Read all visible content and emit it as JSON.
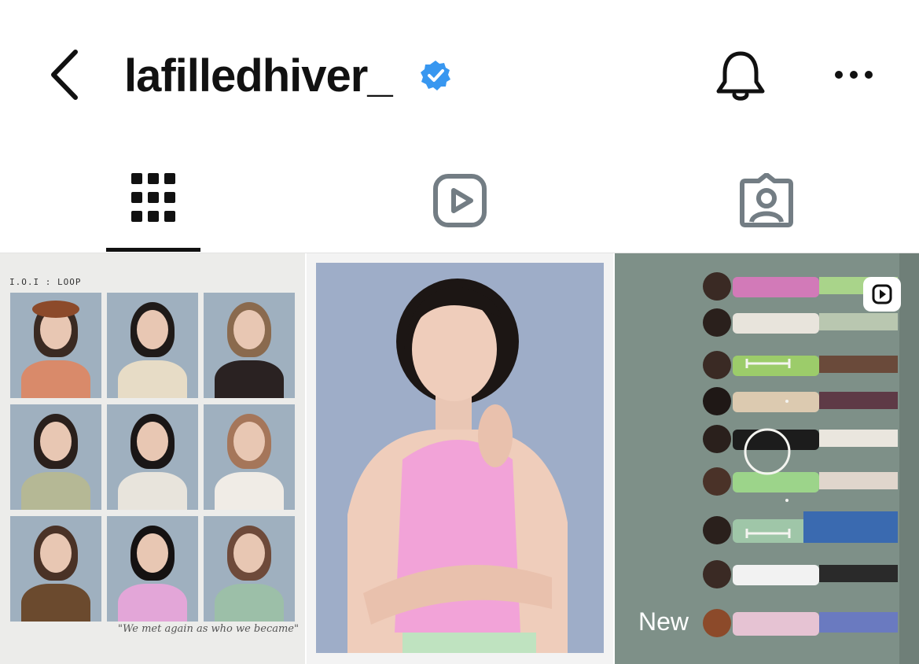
{
  "header": {
    "username": "lafilledhiver_",
    "verified": true
  },
  "tabs": [
    {
      "name": "posts",
      "icon": "grid-icon",
      "active": true
    },
    {
      "name": "reels",
      "icon": "reels-icon",
      "active": false
    },
    {
      "name": "tagged",
      "icon": "tagged-icon",
      "active": false
    }
  ],
  "posts": [
    {
      "type": "image",
      "collage_title": "I.O.I : LOOP",
      "caption": "\"We met again as who we became\""
    },
    {
      "type": "image"
    },
    {
      "type": "reel",
      "badge": "New"
    }
  ],
  "colors": {
    "verified_blue": "#3897f0",
    "icon_gray": "#737d84",
    "text": "#111111"
  }
}
